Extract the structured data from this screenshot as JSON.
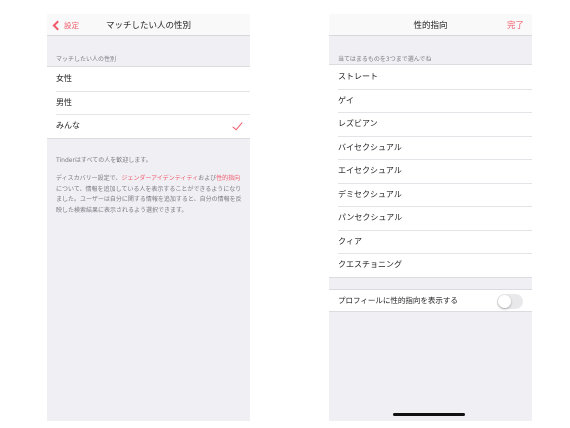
{
  "left": {
    "nav": {
      "back_label": "設定",
      "title": "マッチしたい人の性別"
    },
    "section_header": "マッチしたい人の性別",
    "options": [
      {
        "label": "女性",
        "selected": false
      },
      {
        "label": "男性",
        "selected": false
      },
      {
        "label": "みんな",
        "selected": true
      }
    ],
    "footer": {
      "line1": "Tinderはすべての人を歓迎します。",
      "part1": "ディスカバリー設定で、",
      "link1": "ジェンダーアイデンティティ",
      "part2": "および",
      "link2": "性的指向",
      "part3": "について、情報を追加している人を表示することができるようになりました。ユーザーは自分に関する情報を追加すると、自分の情報を反映した検索結果に表示されるよう選択できます。"
    }
  },
  "right": {
    "nav": {
      "title": "性的指向",
      "done_label": "完了"
    },
    "section_header": "当てはまるものを3つまで選んでね",
    "options": [
      "ストレート",
      "ゲイ",
      "レズビアン",
      "バイセクシュアル",
      "エイセクシュアル",
      "デミセクシュアル",
      "パンセクシュアル",
      "クィア",
      "クエスチョニング"
    ],
    "toggle": {
      "label": "プロフィールに性的指向を表示する",
      "on": false
    }
  },
  "colors": {
    "accent": "#f15a6b",
    "background": "#efeff4"
  }
}
